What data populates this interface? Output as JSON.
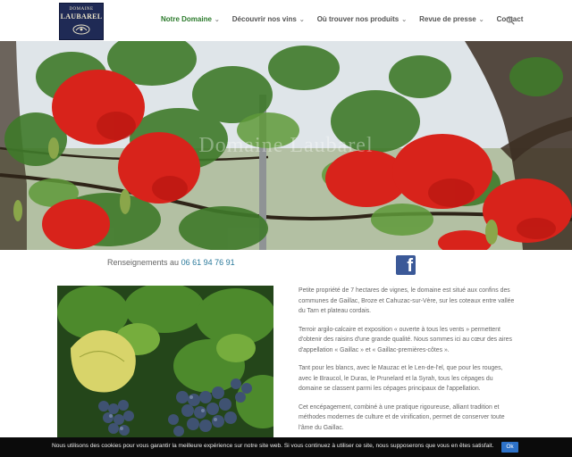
{
  "brand": {
    "logo_line1": "DOMAINE",
    "logo_line2": "LAUBAREL"
  },
  "nav": {
    "items": [
      {
        "label": "Notre Domaine",
        "has_dropdown": true,
        "active": true
      },
      {
        "label": "Découvrir nos vins",
        "has_dropdown": true
      },
      {
        "label": "Où trouver nos produits",
        "has_dropdown": true
      },
      {
        "label": "Revue de presse",
        "has_dropdown": true
      },
      {
        "label": "Contact",
        "has_dropdown": false
      }
    ],
    "search_icon": "search-icon"
  },
  "hero": {
    "title": "Domaine Laubarel"
  },
  "contact": {
    "prefix": "Renseignements au",
    "phone": "06 61 94 76 91",
    "social_icon": "facebook-icon"
  },
  "content": {
    "p1": "Petite propriété de 7 hectares de vignes, le domaine est situé aux confins des communes de Gaillac, Broze et Cahuzac-sur-Vère, sur les coteaux entre vallée du Tarn et plateau cordais.",
    "p2": "Terroir argilo-calcaire et exposition « ouverte à tous les vents » permettent d'obtenir des raisins d'une grande qualité. Nous sommes ici au cœur des aires d'appellation « Gaillac » et « Gaillac-premières-côtes ».",
    "p3": "Tant pour les blancs, avec le Mauzac et le Len-de-l'el, que pour les rouges, avec le Braucol, le Duras, le Prunelard et la Syrah, tous les cépages du domaine se classent parmi les cépages principaux de l'appellation.",
    "p4": "Cet encépagement, combiné à une pratique rigoureuse, alliant tradition et méthodes modernes de culture et de vinification, permet de conserver toute l'âme du Gaillac."
  },
  "cookie": {
    "text": "Nous utilisons des cookies pour vous garantir la meilleure expérience sur notre site web. Si vous continuez à utiliser ce site, nous supposerons que vous en êtes satisfait.",
    "ok_label": "Ok"
  },
  "colors": {
    "accent": "#2b7a2b",
    "phone": "#2b7a9b",
    "facebook": "#3b5998",
    "cookie_bg": "#0b0b0b",
    "cookie_button": "#2d72c9",
    "logo_bg": "#1f2a55"
  }
}
